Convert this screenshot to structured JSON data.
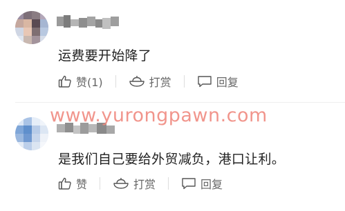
{
  "comments": [
    {
      "text": "运费要开始降了",
      "like_label": "赞(1)",
      "tip_label": "打赏",
      "reply_label": "回复"
    },
    {
      "text": "是我们自己要给外贸减负，港口让利。",
      "like_label": "赞",
      "tip_label": "打赏",
      "reply_label": "回复"
    }
  ],
  "watermark": "www.yurongpawn.com",
  "icons": {
    "like": "thumbs-up-icon",
    "tip": "tip-bowl-icon",
    "reply": "speech-bubble-icon"
  },
  "colors": {
    "text": "#222222",
    "action_text": "#666666",
    "watermark": "#f08a80"
  }
}
